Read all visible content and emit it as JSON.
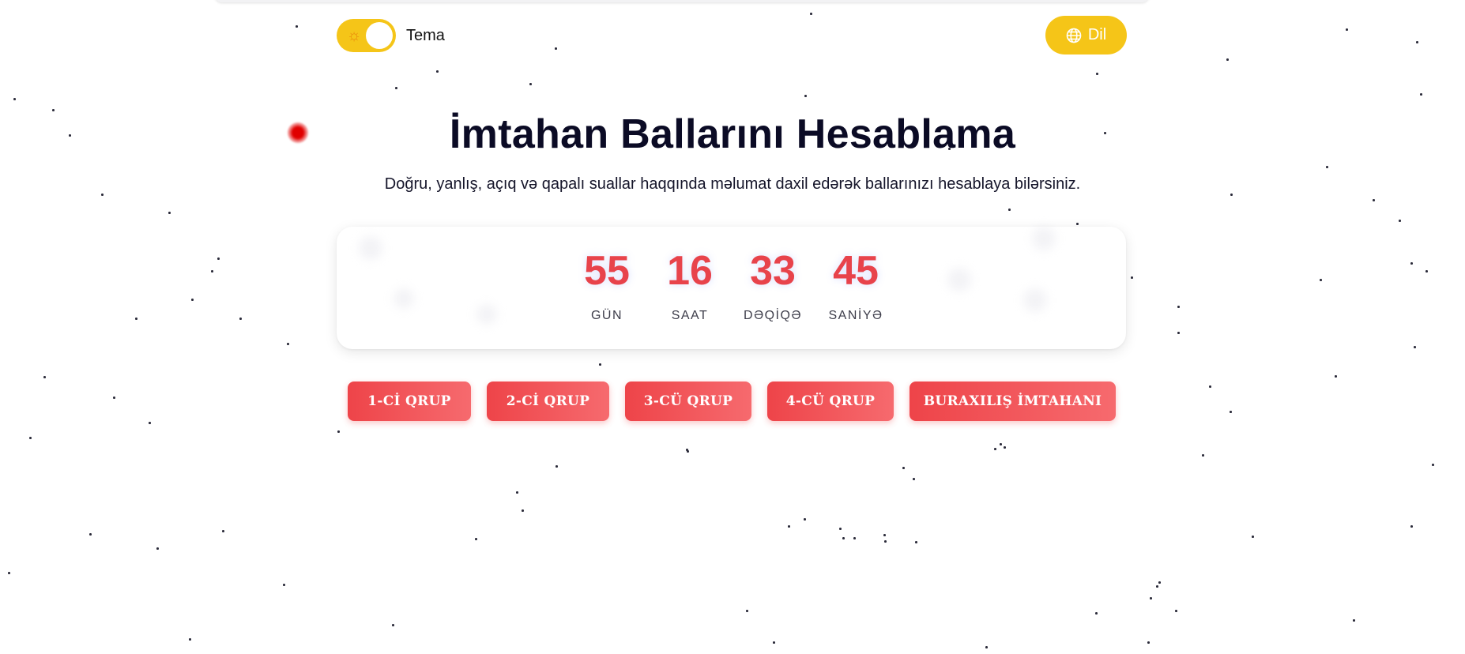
{
  "header": {
    "theme_label": "Tema",
    "language_label": "Dil",
    "theme_icon": "sun-icon",
    "language_icon": "globe-icon"
  },
  "main": {
    "title": "İmtahan Ballarını Hesablama",
    "subtitle": "Doğru, yanlış, açıq və qapalı suallar haqqında məlumat daxil edərək ballarınızı hesablaya bilərsiniz."
  },
  "countdown": {
    "days": {
      "value": "55",
      "label": "GÜN"
    },
    "hours": {
      "value": "16",
      "label": "SAAT"
    },
    "minutes": {
      "value": "33",
      "label": "DƏQİQƏ"
    },
    "seconds": {
      "value": "45",
      "label": "SANİYƏ"
    }
  },
  "groups": [
    {
      "label": "1-Cİ QRUP"
    },
    {
      "label": "2-Cİ QRUP"
    },
    {
      "label": "3-CÜ QRUP"
    },
    {
      "label": "4-CÜ QRUP"
    },
    {
      "label": "BURAXILIŞ İMTAHANI"
    }
  ],
  "colors": {
    "accent_yellow": "#f5c518",
    "accent_red": "#ee4449",
    "title_dark": "#0b0b25"
  }
}
